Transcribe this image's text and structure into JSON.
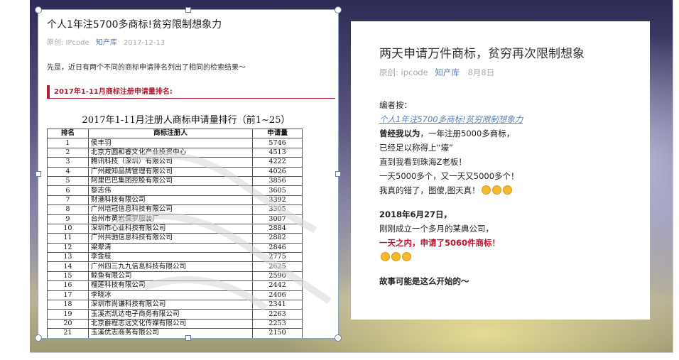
{
  "left_image": {
    "title": "个人1年注5700多商标!贫穷限制想象力",
    "meta": {
      "source_label": "原创:",
      "author": "IPcode",
      "publisher": "知产库",
      "date": "2017-12-13"
    },
    "intro": "先是，近日有两个不同的商标申请排名列出了相同的检索结果～",
    "section_heading": "2017年1-11月商标注册申请量排名:",
    "table_title": "2017年1-11月注册人商标申请量排行（前1~25）",
    "table": {
      "headers": [
        "排名",
        "商标注册人",
        "申请量"
      ],
      "rows": [
        [
          "1",
          "侯丰羽",
          "5746"
        ],
        [
          "2",
          "北京方圆和睿文化产业投资中心",
          "4513"
        ],
        [
          "3",
          "腾讯科技（深圳）有限公司",
          "4222"
        ],
        [
          "4",
          "广州藏知品牌管理有限公司",
          "4026"
        ],
        [
          "5",
          "阿里巴巴集团控股有限公司",
          "3856"
        ],
        [
          "6",
          "黎志伟",
          "3605"
        ],
        [
          "7",
          "财港科技有限公司",
          "3392"
        ],
        [
          "8",
          "广州培冠信息科技有限公司",
          "3305"
        ],
        [
          "9",
          "台州市黄岩保罗服装厂",
          "3007"
        ],
        [
          "10",
          "深圳市心亚科技有限公司",
          "2884"
        ],
        [
          "11",
          "广州共驰信息科技有限公司",
          "2882"
        ],
        [
          "12",
          "梁翠清",
          "2846"
        ],
        [
          "13",
          "李金枝",
          "2775"
        ],
        [
          "14",
          "广州四三九九信息科技有限公司",
          "2625"
        ],
        [
          "15",
          "鲸鱼有限公司",
          "2590"
        ],
        [
          "16",
          "榴莲科技有限公司",
          "2442"
        ],
        [
          "17",
          "李晓冰",
          "2406"
        ],
        [
          "18",
          "深圳市尚谦科技有限公司",
          "2341"
        ],
        [
          "19",
          "玉溪杰凯达电子商务有限公司",
          "2263"
        ],
        [
          "20",
          "北京爵程志远文化传媒有限公司",
          "2253"
        ],
        [
          "21",
          "玉溪优志商务有限公司",
          "2150"
        ]
      ]
    }
  },
  "right_image": {
    "title": "两天申请万件商标，贫穷再次限制想象",
    "meta": {
      "source_label": "原创:",
      "author": "ipcode",
      "publisher": "知产库",
      "date": "8月8日"
    },
    "editor_note": "编者按：",
    "link_line": "个人1年注5700多商标!贫穷限制想象力",
    "line1_bold": "曾经我以为",
    "line1_rest": "，一年注册5000多商标，",
    "line2": "已经足以称得上“壕”",
    "line3": "直到我看到珠海Z老板！",
    "line4": "一天5000多个，又一天又5000多个！",
    "line5": "我真的错了，图傻,图天真！",
    "date_heading": "2018年6月27日，",
    "line6": "刚刚成立一个多月的某典公司，",
    "highlight": "一天之内，申请了5060件商标！",
    "closing": "故事可能是这么开始的～"
  }
}
